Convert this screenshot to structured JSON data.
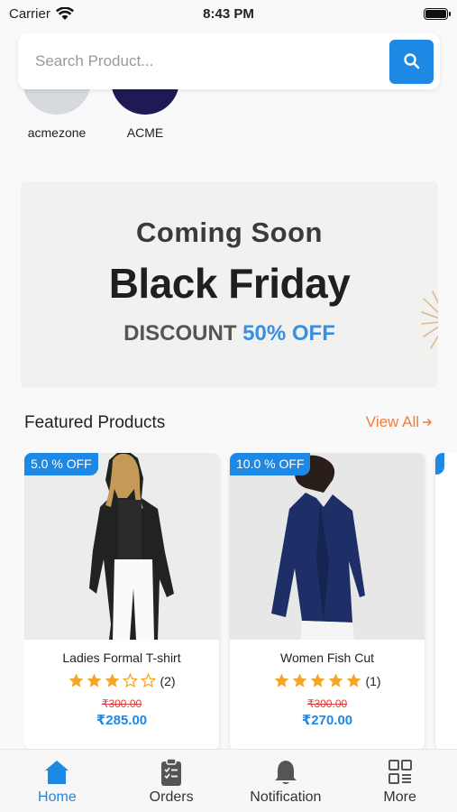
{
  "status_bar": {
    "carrier": "Carrier",
    "time": "8:43 PM"
  },
  "search": {
    "placeholder": "Search Product..."
  },
  "brands": [
    {
      "label": "acmezone",
      "color": "#d6d9dd"
    },
    {
      "label": "ACME",
      "color": "#1d1a55"
    }
  ],
  "banner": {
    "coming": "Coming Soon",
    "title": "Black Friday",
    "discount_prefix": "DISCOUNT",
    "discount_value": "50% OFF"
  },
  "featured": {
    "title": "Featured Products",
    "view_all": "View All"
  },
  "products": [
    {
      "badge": "5.0 % OFF",
      "name": "Ladies Formal T-shirt",
      "rating": 3,
      "rating_count": "(2)",
      "old_price": "₹300.00",
      "price": "₹285.00"
    },
    {
      "badge": "10.0 % OFF",
      "name": "Women Fish Cut",
      "rating": 5,
      "rating_count": "(1)",
      "old_price": "₹300.00",
      "price": "₹270.00"
    }
  ],
  "nav": [
    {
      "label": "Home",
      "icon": "home-icon",
      "active": true
    },
    {
      "label": "Orders",
      "icon": "clipboard-icon",
      "active": false
    },
    {
      "label": "Notification",
      "icon": "bell-icon",
      "active": false
    },
    {
      "label": "More",
      "icon": "grid-icon",
      "active": false
    }
  ],
  "colors": {
    "accent": "#1e88e5",
    "view_all": "#f07d3a",
    "old_price": "#e53935",
    "star": "#f5a623"
  }
}
